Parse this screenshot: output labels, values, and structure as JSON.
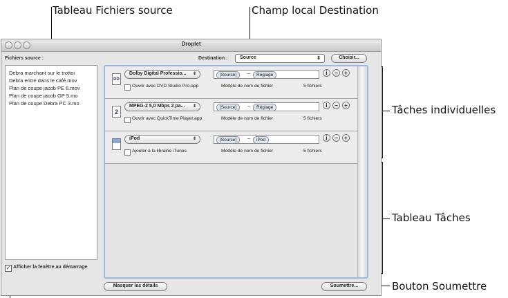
{
  "callouts": {
    "source_table": "Tableau Fichiers source",
    "destination_field": "Champ local Destination",
    "individual_tasks": "Tâches individuelles",
    "tasks_table": "Tableau Tâches",
    "submit_button": "Bouton Soumettre"
  },
  "window": {
    "title": "Droplet",
    "source_label": "Fichiers source :",
    "destination_label": "Destination :",
    "destination_value": "Source",
    "choose_button": "Choisir...",
    "source_files": [
      "Debra marchant sur le trottoi",
      "Debra entre dans le café.mov",
      "Plan de coupe jacob PE 6.mov",
      "Plan de coupe jacob  GP 5.mo",
      "Plan de coupe Debra PC 3.mo"
    ],
    "show_at_startup_label": "Afficher la fenêtre au démarrage",
    "hide_details_button": "Masquer les détails",
    "submit_button": "Soumettre...",
    "tasks": [
      {
        "preset": "Dolby Digital Professio...",
        "icon": "dolby-icon",
        "token1": "[Source]",
        "token2": "Réglage",
        "checkbox_label": "Ouvrir avec DVD Studio Pro.app",
        "template_label": "Modèle de nom de fichier",
        "count": "5 fichiers"
      },
      {
        "preset": "MPEG-2 5,0 Mbps 2 pa...",
        "icon": "mpeg2-icon",
        "token1": "[Source]",
        "token2": "Réglage",
        "checkbox_label": "Ouvrir avec QuickTime Player.app",
        "template_label": "Modèle de nom de fichier",
        "count": "5 fichiers"
      },
      {
        "preset": "iPod",
        "icon": "ipod-icon",
        "token1": "[Source]",
        "token2": "iPod",
        "checkbox_label": "Ajouter à la librairie iTunes",
        "template_label": "Modèle de nom de fichier",
        "count": "5 fichiers"
      }
    ],
    "doc_glyphs": [
      "DD",
      "2",
      ""
    ]
  }
}
